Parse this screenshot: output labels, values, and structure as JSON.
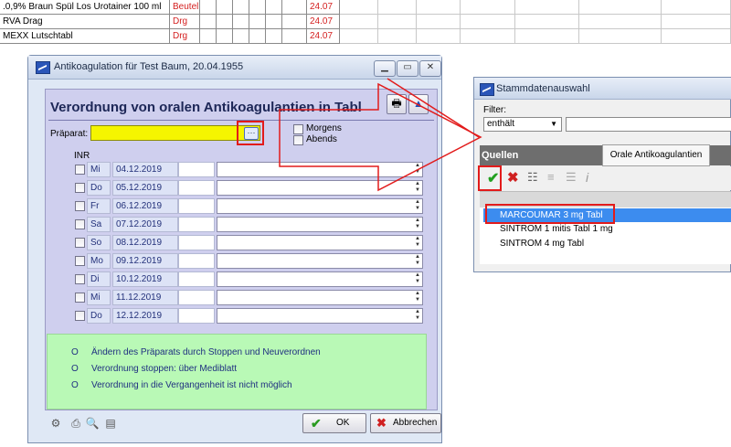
{
  "background_table": {
    "rows": [
      {
        "name": ".0,9% Braun Spül Los Urotainer 100 ml",
        "unit": "Beutel",
        "price": "24.07"
      },
      {
        "name": "RVA Drag",
        "unit": "Drg",
        "price": "24.07"
      },
      {
        "name": "MEXX Lutschtabl",
        "unit": "Drg",
        "price": "24.07"
      }
    ]
  },
  "main_dialog": {
    "title": "Antikoagulation für Test Baum, 20.04.1955",
    "heading": "Verordnung von oralen Antikoagulantien in Tabl",
    "praeparat_label": "Präparat:",
    "praeparat_value": "",
    "browse_button": "···",
    "morgens_label": "Morgens",
    "abends_label": "Abends",
    "inr_label": "INR",
    "rows": [
      {
        "day": "Mi",
        "date": "04.12.2019"
      },
      {
        "day": "Do",
        "date": "05.12.2019"
      },
      {
        "day": "Fr",
        "date": "06.12.2019"
      },
      {
        "day": "Sa",
        "date": "07.12.2019"
      },
      {
        "day": "So",
        "date": "08.12.2019"
      },
      {
        "day": "Mo",
        "date": "09.12.2019"
      },
      {
        "day": "Di",
        "date": "10.12.2019"
      },
      {
        "day": "Mi",
        "date": "11.12.2019"
      },
      {
        "day": "Do",
        "date": "12.12.2019"
      }
    ],
    "info": [
      "Ändern des Präparats durch Stoppen und Neuverordnen",
      "Verordnung stoppen: über Mediblatt",
      "Verordnung in die Vergangenheit ist nicht möglich"
    ],
    "info_bullet": "O",
    "ok_label": "OK",
    "cancel_label": "Abbrechen"
  },
  "stamm_dialog": {
    "title": "Stammdatenauswahl",
    "filter_label": "Filter:",
    "filter_mode": "enthält",
    "quellen_label": "Quellen",
    "tab_label": "Orale Antikoagulantien",
    "items": [
      "MARCOUMAR 3 mg Tabl",
      "SINTROM 1 mitis Tabl 1 mg",
      "SINTROM 4 mg Tabl"
    ],
    "selected_index": 0
  },
  "colors": {
    "highlight": "#e21b1b",
    "dialog_body": "#cfcfee",
    "info_box": "#b9f9b6",
    "praeparat_field": "#f5f500",
    "selected_row": "#3c8cef"
  }
}
